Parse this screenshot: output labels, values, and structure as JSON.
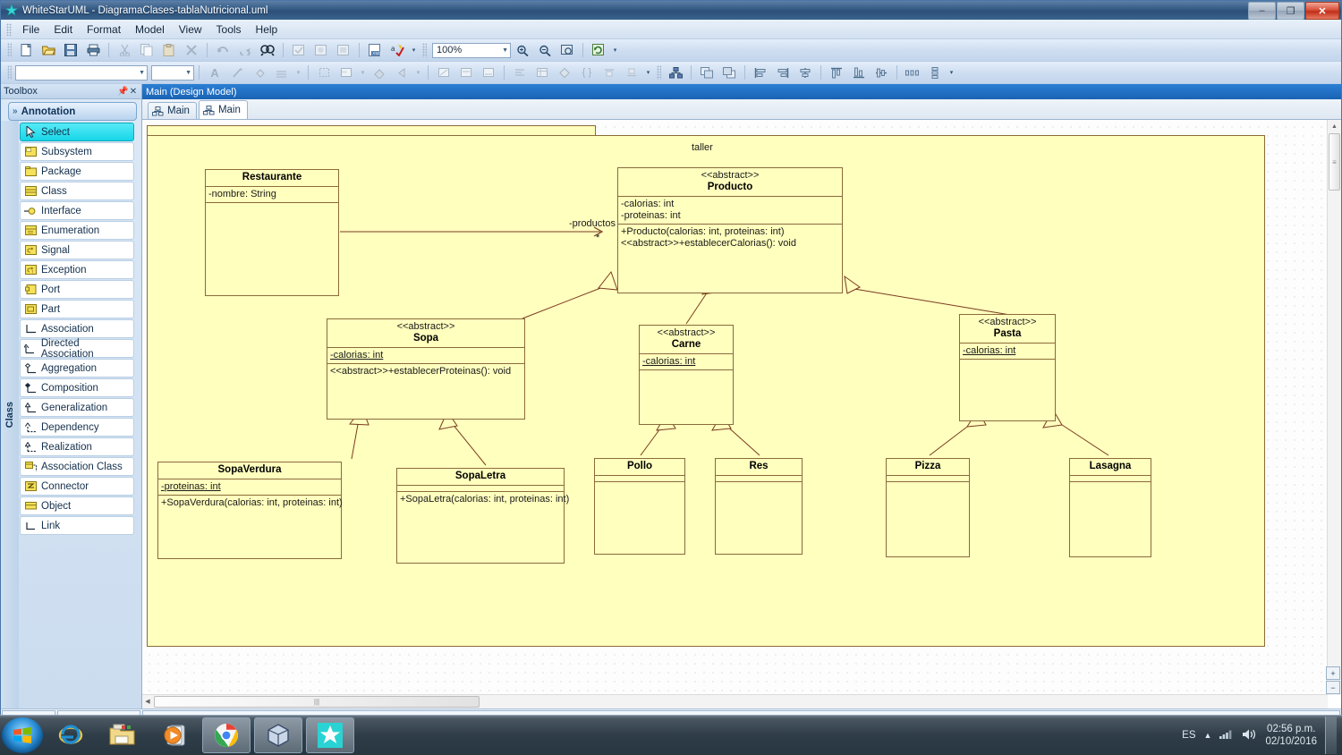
{
  "window": {
    "title": "WhiteStarUML - DiagramaClases-tablaNutricional.uml",
    "app_icon": "star-icon",
    "minimize_label": "–",
    "maximize_label": "❐",
    "close_label": "✕"
  },
  "menu": {
    "items": [
      {
        "label": "File"
      },
      {
        "label": "Edit"
      },
      {
        "label": "Format"
      },
      {
        "label": "Model"
      },
      {
        "label": "View"
      },
      {
        "label": "Tools"
      },
      {
        "label": "Help"
      }
    ]
  },
  "toolbar_main": {
    "buttons": [
      {
        "name": "new-icon",
        "glyph": "⬜"
      },
      {
        "name": "open-icon",
        "glyph": "📂"
      },
      {
        "name": "save-icon",
        "glyph": "💾"
      },
      {
        "name": "print-icon",
        "glyph": "🖨"
      },
      {
        "name": "cut-icon",
        "glyph": "✂"
      },
      {
        "name": "copy-icon",
        "glyph": "⧉"
      },
      {
        "name": "paste-icon",
        "glyph": "📋"
      },
      {
        "name": "delete-icon",
        "glyph": "✕"
      },
      {
        "name": "undo-icon",
        "glyph": "↶"
      },
      {
        "name": "redo-icon",
        "glyph": "↷"
      },
      {
        "name": "find-icon",
        "glyph": "🔍"
      },
      {
        "name": "group-icon",
        "glyph": "⬚"
      },
      {
        "name": "ungroup-icon",
        "glyph": "⬚"
      },
      {
        "name": "layer-icon",
        "glyph": "⬚"
      },
      {
        "name": "export-icon",
        "glyph": "⬜"
      },
      {
        "name": "spell-icon",
        "glyph": "✓"
      }
    ],
    "zoom_value": "100%",
    "zoom_buttons": [
      {
        "name": "zoom-in-icon",
        "glyph": "⊕"
      },
      {
        "name": "zoom-out-icon",
        "glyph": "⊖"
      },
      {
        "name": "fit-to-window-icon",
        "glyph": "▣"
      },
      {
        "name": "refresh-icon",
        "glyph": "↻"
      }
    ]
  },
  "toolbar_format": {
    "font_combo_value": "",
    "size_combo_value": "",
    "buttons": [
      {
        "name": "font-color-icon",
        "glyph": "A"
      },
      {
        "name": "line-style-icon",
        "glyph": "╱"
      },
      {
        "name": "fill-color-icon",
        "glyph": "◖"
      },
      {
        "name": "line-width-icon",
        "glyph": "≡"
      },
      {
        "name": "auto-resize-icon",
        "glyph": "⬚"
      },
      {
        "name": "stereotype-display-icon",
        "glyph": "⊞"
      },
      {
        "name": "shadow-icon",
        "glyph": "◗"
      },
      {
        "name": "suppress-attributes-icon",
        "glyph": "◁"
      },
      {
        "name": "suppress-operations-icon",
        "glyph": "⬚"
      },
      {
        "name": "show-attributes-icon",
        "glyph": "⬚"
      },
      {
        "name": "show-operations-icon",
        "glyph": "⬚"
      },
      {
        "name": "show-signature-icon",
        "glyph": "≡"
      },
      {
        "name": "show-visibility-icon",
        "glyph": "▦"
      },
      {
        "name": "show-property-icon",
        "glyph": "◈"
      },
      {
        "name": "show-namespace-icon",
        "glyph": "{ }"
      },
      {
        "name": "align-top-icon",
        "glyph": "┴"
      },
      {
        "name": "align-bottom-icon",
        "glyph": "┬"
      }
    ]
  },
  "toolbar_align": {
    "buttons": [
      {
        "name": "diagram-icon",
        "glyph": "⛓"
      },
      {
        "name": "bring-to-front-icon",
        "glyph": "⧉"
      },
      {
        "name": "send-to-back-icon",
        "glyph": "⧉"
      },
      {
        "name": "align-left-icon",
        "glyph": "▐"
      },
      {
        "name": "align-right-icon",
        "glyph": "▌"
      },
      {
        "name": "align-center-icon",
        "glyph": "║"
      },
      {
        "name": "align-top2-icon",
        "glyph": "▀"
      },
      {
        "name": "align-bottom2-icon",
        "glyph": "▄"
      },
      {
        "name": "align-middle-icon",
        "glyph": "═"
      },
      {
        "name": "space-horizontally-icon",
        "glyph": "▫"
      },
      {
        "name": "space-vertically-icon",
        "glyph": "▫"
      }
    ]
  },
  "toolbox": {
    "title": "Toolbox",
    "pin_icon": "pin-icon",
    "close_icon": "close-icon",
    "group_label": "Annotation",
    "rail_label": "Class",
    "items": [
      {
        "label": "Select",
        "icon": "cursor-icon",
        "selected": true
      },
      {
        "label": "Subsystem",
        "icon": "subsystem-icon",
        "selected": false
      },
      {
        "label": "Package",
        "icon": "package-icon",
        "selected": false
      },
      {
        "label": "Class",
        "icon": "class-icon",
        "selected": false
      },
      {
        "label": "Interface",
        "icon": "interface-icon",
        "selected": false
      },
      {
        "label": "Enumeration",
        "icon": "enumeration-icon",
        "selected": false
      },
      {
        "label": "Signal",
        "icon": "signal-icon",
        "selected": false
      },
      {
        "label": "Exception",
        "icon": "exception-icon",
        "selected": false
      },
      {
        "label": "Port",
        "icon": "port-icon",
        "selected": false
      },
      {
        "label": "Part",
        "icon": "part-icon",
        "selected": false
      },
      {
        "label": "Association",
        "icon": "association-icon",
        "selected": false
      },
      {
        "label": "Directed Association",
        "icon": "directed-association-icon",
        "selected": false
      },
      {
        "label": "Aggregation",
        "icon": "aggregation-icon",
        "selected": false
      },
      {
        "label": "Composition",
        "icon": "composition-icon",
        "selected": false
      },
      {
        "label": "Generalization",
        "icon": "generalization-icon",
        "selected": false
      },
      {
        "label": "Dependency",
        "icon": "dependency-icon",
        "selected": false
      },
      {
        "label": "Realization",
        "icon": "realization-icon",
        "selected": false
      },
      {
        "label": "Association Class",
        "icon": "association-class-icon",
        "selected": false
      },
      {
        "label": "Connector",
        "icon": "connector-icon",
        "selected": false
      },
      {
        "label": "Object",
        "icon": "object-icon",
        "selected": false
      },
      {
        "label": "Link",
        "icon": "link-icon",
        "selected": false
      }
    ]
  },
  "editor": {
    "caption": "Main (Design Model)",
    "tabs": [
      {
        "label": "Main",
        "active": false
      },
      {
        "label": "Main",
        "active": true
      }
    ]
  },
  "diagram": {
    "package_name": "taller",
    "classes": [
      {
        "id": "restaurante",
        "name": "Restaurante",
        "stereotype": "",
        "attributes": [
          {
            "text": "-nombre: String",
            "static": false
          }
        ],
        "operations": []
      },
      {
        "id": "producto",
        "name": "Producto",
        "stereotype": "<<abstract>>",
        "attributes": [
          {
            "text": "-calorias: int",
            "static": false
          },
          {
            "text": "-proteinas: int",
            "static": false
          }
        ],
        "operations": [
          {
            "text": "+Producto(calorias: int, proteinas: int)",
            "static": false
          },
          {
            "text": "<<abstract>>+establecerCalorias(): void",
            "static": false
          }
        ]
      },
      {
        "id": "sopa",
        "name": "Sopa",
        "stereotype": "<<abstract>>",
        "attributes": [
          {
            "text": "-calorias: int",
            "static": true
          }
        ],
        "operations": [
          {
            "text": "<<abstract>>+establecerProteinas(): void",
            "static": false
          }
        ]
      },
      {
        "id": "carne",
        "name": "Carne",
        "stereotype": "<<abstract>>",
        "attributes": [
          {
            "text": "-calorias: int",
            "static": true
          }
        ],
        "operations": []
      },
      {
        "id": "pasta",
        "name": "Pasta",
        "stereotype": "<<abstract>>",
        "attributes": [
          {
            "text": "-calorias: int",
            "static": true
          }
        ],
        "operations": []
      },
      {
        "id": "sopaverdura",
        "name": "SopaVerdura",
        "stereotype": "",
        "attributes": [
          {
            "text": "-proteinas: int",
            "static": true
          }
        ],
        "operations": [
          {
            "text": "+SopaVerdura(calorias: int, proteinas: int)",
            "static": false
          }
        ]
      },
      {
        "id": "sopaletra",
        "name": "SopaLetra",
        "stereotype": "",
        "attributes": [],
        "operations": [
          {
            "text": "+SopaLetra(calorias: int, proteinas: int)",
            "static": false
          }
        ]
      },
      {
        "id": "pollo",
        "name": "Pollo",
        "stereotype": "",
        "attributes": [],
        "operations": []
      },
      {
        "id": "res",
        "name": "Res",
        "stereotype": "",
        "attributes": [],
        "operations": []
      },
      {
        "id": "pizza",
        "name": "Pizza",
        "stereotype": "",
        "attributes": [],
        "operations": []
      },
      {
        "id": "lasagna",
        "name": "Lasagna",
        "stereotype": "",
        "attributes": [],
        "operations": []
      }
    ],
    "association_role_label": "-productos",
    "association_multiplicity": "*",
    "colors": {
      "fill": "#ffffbe",
      "border": "#8a6b3a",
      "line": "#7a3b1f"
    }
  },
  "canvas_controls": {
    "zoom_fit_label": "+",
    "zoom_reset_label": "−"
  },
  "taskbar": {
    "apps": [
      {
        "name": "internet-explorer-icon",
        "pressed": false
      },
      {
        "name": "windows-explorer-icon",
        "pressed": false
      },
      {
        "name": "media-player-icon",
        "pressed": false
      },
      {
        "name": "google-chrome-icon",
        "pressed": true
      },
      {
        "name": "virtualbox-icon",
        "pressed": true
      },
      {
        "name": "whitestaruml-icon",
        "pressed": true
      }
    ],
    "tray": {
      "language": "ES",
      "show_hidden_icon": "chevron-up-icon",
      "network_icon": "network-icon",
      "volume_icon": "volume-icon",
      "time": "02:56 p.m.",
      "date": "02/10/2016"
    }
  }
}
